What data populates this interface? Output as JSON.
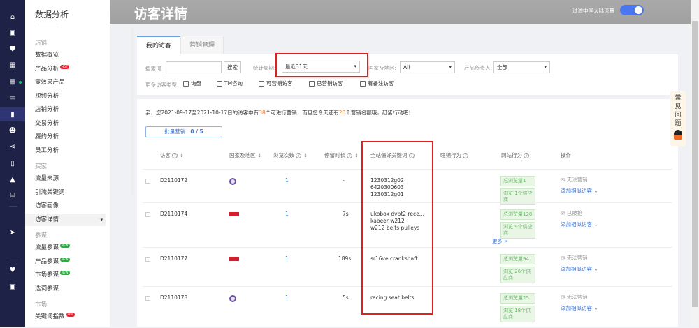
{
  "iconbar": [
    "home-icon",
    "store-icon",
    "shield-icon",
    "grid-icon",
    "calendar-icon",
    "message-icon",
    "chart-icon",
    "users-icon",
    "share-icon",
    "clipboard-icon",
    "car-icon",
    "bank-icon",
    "send-icon",
    "heart-icon",
    "briefcase-icon"
  ],
  "sidebar": {
    "title": "数据分析",
    "groups": [
      {
        "label": "店铺",
        "items": [
          {
            "label": "数据概览"
          },
          {
            "label": "产品分析",
            "badge": "HOT"
          },
          {
            "label": "零效果产品"
          },
          {
            "label": "视频分析"
          },
          {
            "label": "店铺分析"
          },
          {
            "label": "交易分析"
          },
          {
            "label": "履约分析"
          },
          {
            "label": "员工分析"
          }
        ]
      },
      {
        "label": "买家",
        "items": [
          {
            "label": "流量来源"
          },
          {
            "label": "引流关键词"
          },
          {
            "label": "访客画像"
          },
          {
            "label": "访客详情"
          }
        ]
      },
      {
        "label": "参谋",
        "items": [
          {
            "label": "流量参谋",
            "badge": "NEW"
          },
          {
            "label": "产品参谋",
            "badge": "NEW"
          },
          {
            "label": "市场参谋",
            "badge": "NEW"
          },
          {
            "label": "选词参谋"
          }
        ]
      },
      {
        "label": "市场",
        "items": [
          {
            "label": "关键词指数",
            "badge": "HOT"
          }
        ]
      }
    ]
  },
  "header": {
    "title": "访客详情",
    "filter_label": "过滤中国大陆流量",
    "filter_on": true
  },
  "tabs": [
    "我的访客",
    "营销管理"
  ],
  "filters": {
    "search_label": "搜索词:",
    "search_value": "",
    "search_button": "搜索",
    "period_label": "统计周期:",
    "period_value": "最近31天",
    "region_label": "国家及地区:",
    "region_value": "All",
    "owner_label": "产品负责人:",
    "owner_value": "全部",
    "types_label": "更多访客类型:",
    "types": [
      "询盘",
      "TM咨询",
      "可营销访客",
      "已营销访客",
      "有备注访客"
    ]
  },
  "notice": {
    "pre": "亲，您2021-09-17至2021-10-17日的访客中有",
    "n1": "38",
    "mid": "个可进行营销，而且您今天还有",
    "n2": "20",
    "post": "个营销名额哦，赶紧行动吧！"
  },
  "bulk": {
    "label": "批量营销",
    "count": "0 / 5"
  },
  "table": {
    "headers": [
      "访客",
      "国家及地区",
      "浏览次数",
      "停留时长",
      "全站偏好关键词",
      "旺铺行为",
      "网站行为",
      "操作"
    ],
    "rows": [
      {
        "id": "D2110172",
        "flag": "tw",
        "views": "1",
        "stay": "-",
        "keywords": [
          "1230312g02",
          "6420300603",
          "1230312g01"
        ],
        "total": "总浏览量1",
        "suppliers": "浏览 1个供应商",
        "status": "无法营销",
        "add": "添加相似访客"
      },
      {
        "id": "D2110174",
        "flag": "red",
        "views": "1",
        "stay": "7s",
        "keywords": [
          "ukobox dvbt2 rece...",
          "kabeer w212",
          "w212 belts pulleys"
        ],
        "total": "总浏览量128",
        "suppliers": "浏览 9个供应商",
        "status": "已被抢",
        "add": "添加相似访客",
        "more": "更多"
      },
      {
        "id": "D2110177",
        "flag": "red",
        "views": "1",
        "stay": "189s",
        "keywords": [
          "sr16ve crankshaft"
        ],
        "total": "总浏览量94",
        "suppliers": "浏览 26个供应商",
        "status": "无法营销",
        "add": "添加相似访客"
      },
      {
        "id": "D2110178",
        "flag": "tw",
        "views": "1",
        "stay": "5s",
        "keywords": [
          "racing seat belts"
        ],
        "total": "总浏览量25",
        "suppliers": "浏览 18个供应商",
        "status": "无法营销",
        "add": "添加相似访客"
      }
    ]
  },
  "faq": "常见问题"
}
